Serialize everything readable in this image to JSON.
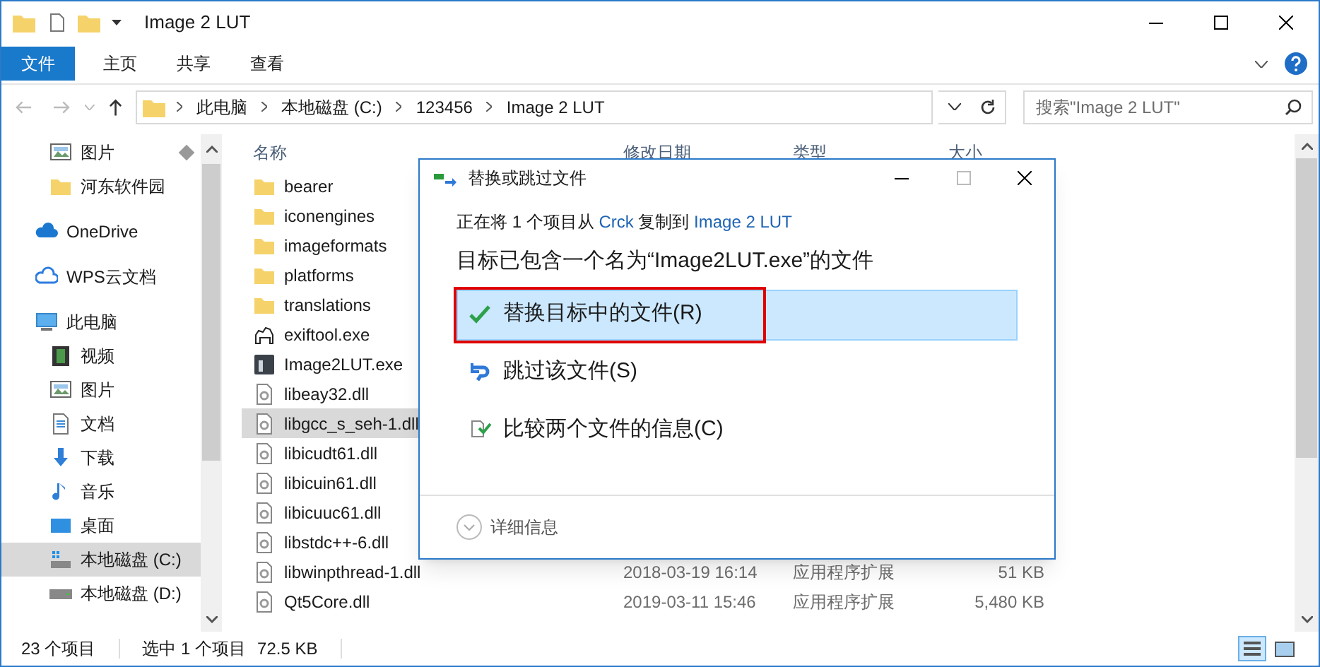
{
  "window": {
    "title": "Image 2 LUT"
  },
  "ribbon_tabs": [
    {
      "label": "文件",
      "selected": true
    },
    {
      "label": "主页",
      "selected": false
    },
    {
      "label": "共享",
      "selected": false
    },
    {
      "label": "查看",
      "selected": false
    }
  ],
  "address": {
    "breadcrumbs": [
      "此电脑",
      "本地磁盘 (C:)",
      "123456",
      "Image 2 LUT"
    ],
    "search_placeholder": "搜索\"Image 2 LUT\""
  },
  "quick_access": [
    {
      "label": "图片",
      "pinned": true,
      "selected": false
    },
    {
      "label": "河东软件园",
      "pinned": false,
      "selected": false
    }
  ],
  "nav": [
    {
      "label": "OneDrive",
      "selected": false
    },
    {
      "label": "WPS云文档",
      "selected": false
    },
    {
      "label": "此电脑",
      "selected": false,
      "children": [
        {
          "label": "视频",
          "selected": false
        },
        {
          "label": "图片",
          "selected": false
        },
        {
          "label": "文档",
          "selected": false
        },
        {
          "label": "下载",
          "selected": false
        },
        {
          "label": "音乐",
          "selected": false
        },
        {
          "label": "桌面",
          "selected": false
        },
        {
          "label": "本地磁盘 (C:)",
          "selected": true
        },
        {
          "label": "本地磁盘 (D:)",
          "selected": false
        }
      ]
    }
  ],
  "columns": [
    "名称",
    "修改日期",
    "类型",
    "大小"
  ],
  "files": [
    {
      "name": "bearer",
      "kind": "folder",
      "selected": false
    },
    {
      "name": "iconengines",
      "kind": "folder",
      "selected": false
    },
    {
      "name": "imageformats",
      "kind": "folder",
      "selected": false
    },
    {
      "name": "platforms",
      "kind": "folder",
      "selected": false
    },
    {
      "name": "translations",
      "kind": "folder",
      "selected": false
    },
    {
      "name": "exiftool.exe",
      "kind": "program",
      "selected": false
    },
    {
      "name": "Image2LUT.exe",
      "kind": "program",
      "selected": false
    },
    {
      "name": "libeay32.dll",
      "kind": "library",
      "selected": false
    },
    {
      "name": "libgcc_s_seh-1.dll",
      "kind": "library",
      "selected": true
    },
    {
      "name": "libicudt61.dll",
      "kind": "library",
      "selected": false
    },
    {
      "name": "libicuin61.dll",
      "kind": "library",
      "selected": false
    },
    {
      "name": "libicuuc61.dll",
      "kind": "library",
      "selected": false
    },
    {
      "name": "libstdc++-6.dll",
      "kind": "library",
      "selected": false
    },
    {
      "name": "libwinpthread-1.dll",
      "kind": "library",
      "selected": false,
      "modified": "2018-03-19 16:14",
      "type": "应用程序扩展",
      "size": "51 KB"
    },
    {
      "name": "Qt5Core.dll",
      "kind": "library",
      "selected": false,
      "modified": "2019-03-11 15:46",
      "type": "应用程序扩展",
      "size": "5,480 KB"
    }
  ],
  "status_bar": {
    "count": "23 个项目",
    "selection": "选中 1 个项目",
    "size": "72.5 KB"
  },
  "dialog": {
    "title": "替换或跳过文件",
    "copy_info": {
      "before": "正在将 1 个项目从",
      "source": "Crck",
      "middle": "复制到",
      "target": "Image 2 LUT"
    },
    "heading": "目标已包含一个名为“Image2LUT.exe”的文件",
    "options": [
      {
        "label": "替换目标中的文件(R)",
        "kind": "replace",
        "selected": true,
        "outlined": true
      },
      {
        "label": "跳过该文件(S)",
        "kind": "skip",
        "selected": false,
        "outlined": false
      },
      {
        "label": "比较两个文件的信息(C)",
        "kind": "compare",
        "selected": false,
        "outlined": false
      }
    ],
    "details": "详细信息"
  }
}
